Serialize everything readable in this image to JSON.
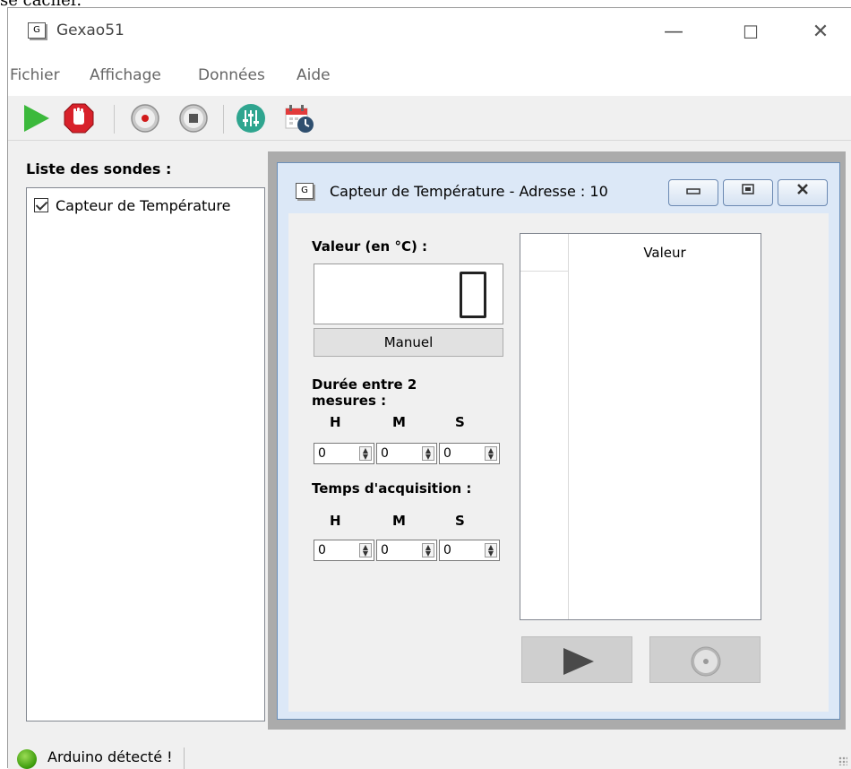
{
  "page_top_text": "se cacher.",
  "window": {
    "icon_letter": "G",
    "title": "Gexao51",
    "minimize": "—",
    "maximize": "☐",
    "close": "✕"
  },
  "menu": [
    "Fichier",
    "Affichage",
    "Données",
    "Aide"
  ],
  "toolbar": {
    "icons": [
      "play-icon",
      "stop-hand-icon",
      "record-icon",
      "stop-icon",
      "equalizer-icon",
      "calendar-clock-icon"
    ]
  },
  "probes": {
    "label": "Liste des sondes :",
    "items": [
      {
        "label": "Capteur de Température",
        "checked": true
      }
    ]
  },
  "subwindow": {
    "icon_letter": "G",
    "title": "Capteur de Température - Adresse : 10",
    "value_label": "Valeur (en °C) :",
    "value": "0",
    "manual_label": "Manuel",
    "interval_label_line1": "Durée entre 2",
    "interval_label_line2": "mesures :",
    "acq_label": "Temps d'acquisition :",
    "units": [
      "H",
      "M",
      "S"
    ],
    "interval": [
      "0",
      "0",
      "0"
    ],
    "acquisition": [
      "0",
      "0",
      "0"
    ],
    "table_header": "Valeur"
  },
  "status": {
    "text": "Arduino détecté !",
    "led_color": "#3a9a0a"
  }
}
